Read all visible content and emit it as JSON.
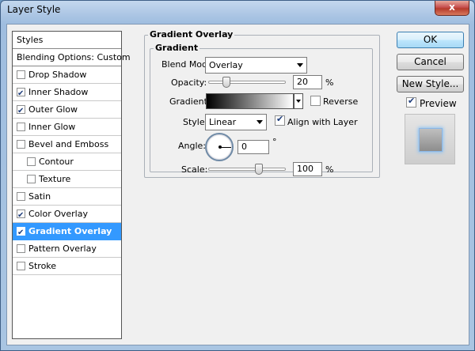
{
  "window": {
    "title": "Layer Style",
    "close_glyph": "x"
  },
  "styles_panel": {
    "header": "Styles",
    "blending": "Blending Options: Custom",
    "items": [
      {
        "label": "Drop Shadow",
        "checked": false,
        "indent": false,
        "selected": false
      },
      {
        "label": "Inner Shadow",
        "checked": true,
        "indent": false,
        "selected": false
      },
      {
        "label": "Outer Glow",
        "checked": true,
        "indent": false,
        "selected": false
      },
      {
        "label": "Inner Glow",
        "checked": false,
        "indent": false,
        "selected": false
      },
      {
        "label": "Bevel and Emboss",
        "checked": false,
        "indent": false,
        "selected": false
      },
      {
        "label": "Contour",
        "checked": false,
        "indent": true,
        "selected": false
      },
      {
        "label": "Texture",
        "checked": false,
        "indent": true,
        "selected": false
      },
      {
        "label": "Satin",
        "checked": false,
        "indent": false,
        "selected": false
      },
      {
        "label": "Color Overlay",
        "checked": true,
        "indent": false,
        "selected": false
      },
      {
        "label": "Gradient Overlay",
        "checked": true,
        "indent": false,
        "selected": true
      },
      {
        "label": "Pattern Overlay",
        "checked": false,
        "indent": false,
        "selected": false
      },
      {
        "label": "Stroke",
        "checked": false,
        "indent": false,
        "selected": false
      }
    ]
  },
  "gradient_overlay": {
    "outer_title": "Gradient Overlay",
    "inner_title": "Gradient",
    "blend_mode_label": "Blend Mode:",
    "blend_mode_value": "Overlay",
    "opacity_label": "Opacity:",
    "opacity_value": "20",
    "opacity_level": 0.2,
    "percent": "%",
    "gradient_label": "Gradient:",
    "reverse_label": "Reverse",
    "reverse_checked": false,
    "style_label": "Style:",
    "style_value": "Linear",
    "align_label": "Align with Layer",
    "align_checked": true,
    "angle_label": "Angle:",
    "angle_value": "0",
    "degree": "°",
    "scale_label": "Scale:",
    "scale_value": "100",
    "scale_level": 0.67
  },
  "buttons": {
    "ok": "OK",
    "cancel": "Cancel",
    "new_style": "New Style...",
    "preview_label": "Preview",
    "preview_checked": true
  },
  "colors": {
    "selection": "#3399ff",
    "dialog_bg": "#f0f0f0",
    "titlebar": "#a9c4e3",
    "close": "#c75050"
  }
}
